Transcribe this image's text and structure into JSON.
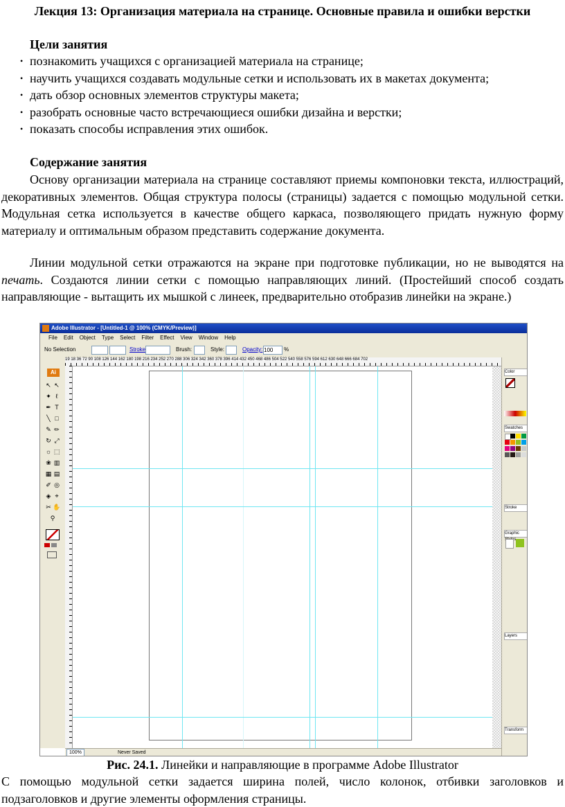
{
  "title": "Лекция 13: Организация материала на странице. Основные правила и ошибки верстки",
  "goals_heading": "Цели занятия",
  "goals": [
    "познакомить учащихся с организацией материала на странице;",
    "научить учащихся создавать модульные сетки и использовать их в макетах документа;",
    "дать обзор основных элементов структуры макета;",
    "разобрать основные часто встречающиеся ошибки дизайна и верстки;",
    "показать способы исправления этих ошибок."
  ],
  "content_heading": "Содержание занятия",
  "para1": "Основу организации материала на странице составляют приемы компоновки текста, иллюстраций, декоративных элементов. Общая структура полосы (страницы) задается с помощью модульной сетки. Модульная сетка используется в качестве общего каркаса, позволяющего придать нужную форму материалу и оптимальным образом представить содержание документа.",
  "para2_before": "Линии модульной сетки отражаются на экране при подготовке публикации, но не выводятся на ",
  "para2_italic": "печать",
  "para2_after": ". Создаются линии сетки с помощью направляющих линий. (Простейший способ создать направляющие - вытащить их мышкой с линеек, предварительно отобразив линейки на экране.)",
  "screenshot": {
    "window_title": "Adobe Illustrator - [Untitled-1 @ 100% (CMYK/Preview)]",
    "menu": [
      "File",
      "Edit",
      "Object",
      "Type",
      "Select",
      "Filter",
      "Effect",
      "View",
      "Window",
      "Help"
    ],
    "control": {
      "selection": "No Selection",
      "stroke": "Stroke:",
      "brush": "Brush:",
      "style": "Style:",
      "opacity": "Opacity:",
      "opacity_value": "100",
      "opacity_unit": "%"
    },
    "ruler_numbers": "19 18 36 72 90 108 126 144 162 180 198 216 234 252 270 288 306 324 342 360 378 396 414 432 450 468 486 504 522 540 558 576 594 612 630 648 666 684 702",
    "ai_badge": "Ai",
    "status_zoom": "100%",
    "status_state": "Never Saved",
    "panels": [
      "Color",
      "Swatches",
      "Stroke",
      "Graphic Styles",
      "Layers",
      "Transform"
    ],
    "colors": {
      "guide": "#6fe6f2",
      "titlebar": "#0a2e9a",
      "ui_bg": "#ece9d8"
    }
  },
  "caption_bold": "Рис. 24.1.",
  "caption_text": " Линейки и направляющие в программе Adobe Illustrator",
  "para3": "С помощью модульной сетки задается ширина полей, число колонок, отбивки заголовков и подзаголовков и другие элементы оформления страницы."
}
